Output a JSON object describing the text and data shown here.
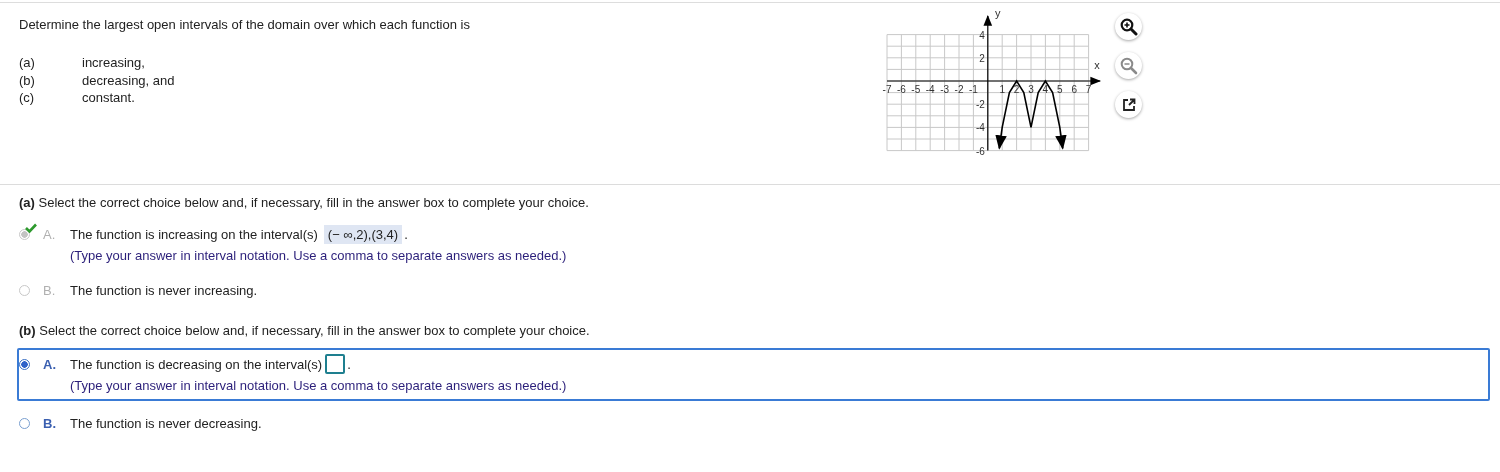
{
  "question": {
    "prompt": "Determine the largest open intervals of the domain over which each function is",
    "items": [
      {
        "label": "(a)",
        "text": "increasing,"
      },
      {
        "label": "(b)",
        "text": "decreasing, and"
      },
      {
        "label": "(c)",
        "text": "constant."
      }
    ]
  },
  "graph": {
    "chart_data": {
      "type": "line",
      "grid": true,
      "xlabel": "x",
      "ylabel": "y",
      "xlim": [
        -7,
        7
      ],
      "ylim": [
        -6,
        4
      ],
      "xticks": [
        -7,
        -6,
        -5,
        -4,
        -3,
        -2,
        -1,
        1,
        2,
        3,
        4,
        5,
        6,
        7
      ],
      "yticks": [
        -6,
        -4,
        -2,
        2,
        4
      ],
      "x": [
        0.8,
        1,
        1.5,
        2,
        2.5,
        3,
        3.5,
        4,
        4.5,
        5,
        5.2
      ],
      "series": [
        {
          "color": "#000000",
          "values": [
            -5.8,
            -4,
            -1,
            0,
            -1,
            -4,
            -1,
            0,
            -1,
            -4,
            -5.8
          ]
        }
      ]
    }
  },
  "parts": [
    {
      "instruction": "**(a)** Select the correct choice below and, if necessary, fill in the answer box to complete your choice.",
      "answered": true,
      "choices": [
        {
          "letter": "A.",
          "text": "The function is increasing on the interval(s)",
          "kind": "input",
          "answer": "(− ∞,2),(3,4)",
          "suffix": ".",
          "hint": "(Type your answer in interval notation. Use a comma to separate answers as needed.)",
          "selected": true,
          "correct": true,
          "focused": false
        },
        {
          "letter": "B.",
          "text": "The function is never increasing.",
          "selected": false,
          "correct": false,
          "focused": false
        }
      ]
    },
    {
      "instruction": "**(b)** Select the correct choice below and, if necessary, fill in the answer box to complete your choice.",
      "answered": false,
      "choices": [
        {
          "letter": "A.",
          "text": "The function is decreasing on the interval(s)",
          "kind": "input",
          "suffix": ".",
          "hint": "(Type your answer in interval notation. Use a comma to separate answers as needed.)",
          "selected": true,
          "correct": false,
          "focused": true
        },
        {
          "letter": "B.",
          "text": "The function is never decreasing.",
          "selected": false,
          "correct": false,
          "focused": false
        }
      ]
    }
  ]
}
